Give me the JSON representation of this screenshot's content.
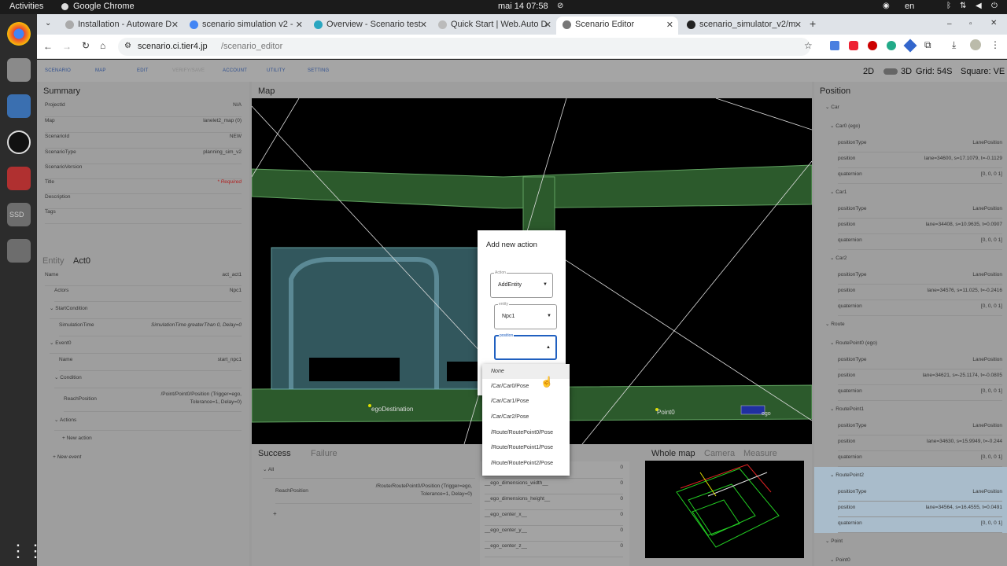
{
  "os": {
    "activities": "Activities",
    "app_name": "Google Chrome",
    "clock": "mai 14  07:58",
    "lang": "en"
  },
  "tabs": [
    {
      "label": "Installation - Autoware D"
    },
    {
      "label": "scenario simulation v2 -"
    },
    {
      "label": "Overview - Scenario test"
    },
    {
      "label": "Quick Start | Web.Auto D"
    },
    {
      "label": "Scenario Editor"
    },
    {
      "label": "scenario_simulator_v2/m"
    }
  ],
  "address": {
    "host": "scenario.ci.tier4.jp",
    "path": "/scenario_editor"
  },
  "menu": {
    "scenario": "SCENARIO",
    "map": "MAP",
    "edit": "EDIT",
    "verify": "VERIFY/SAVE",
    "account": "ACCOUNT",
    "utility": "UTILITY",
    "setting": "SETTING"
  },
  "view": {
    "d2": "2D",
    "d3": "3D",
    "grid": "Grid:  54S",
    "square": "Square:  VE"
  },
  "summary": {
    "title": "Summary",
    "rows": [
      {
        "k": "ProjectId",
        "v": "N/A"
      },
      {
        "k": "Map",
        "v": "lanelet2_map (0)"
      },
      {
        "k": "ScenarioId",
        "v": "NEW"
      },
      {
        "k": "ScenarioType",
        "v": "planning_sim_v2"
      },
      {
        "k": "ScenarioVersion",
        "v": ""
      },
      {
        "k": "Title",
        "v": "* Required"
      },
      {
        "k": "Description",
        "v": ""
      },
      {
        "k": "Tags",
        "v": ""
      }
    ]
  },
  "act": {
    "tab_entity": "Entity",
    "tab_act": "Act0",
    "name_k": "Name",
    "name_v": "act_act1",
    "actors_k": "Actors",
    "actors_v": "Npc1",
    "start_condition": "StartCondition",
    "sim_time_k": "SimulationTime",
    "sim_time_v": "SimulationTime greaterThan 0, Delay=0",
    "event0": "Event0",
    "ev_name_k": "Name",
    "ev_name_v": "start_npc1",
    "condition": "Condition",
    "reach_k": "ReachPosition",
    "reach_v1": "/Point/Point0/Position (Trigger=ego,",
    "reach_v2": "Tolerance=1, Delay=0)",
    "actions": "Actions",
    "new_action": "New action",
    "new_event": "New event"
  },
  "map": {
    "title": "Map",
    "ego_dest": "egoDestination",
    "point0": "Point0",
    "ego": "ego"
  },
  "dialog": {
    "title": "Add new action",
    "action_label": "Action",
    "action_value": "AddEntity",
    "entity_label": "entity",
    "entity_value": "Npc1",
    "position_label": "position"
  },
  "dropdown": [
    "None",
    "/Car/Car0/Pose",
    "/Car/Car1/Pose",
    "/Car/Car2/Pose",
    "/Route/RoutePoint0/Pose",
    "/Route/RoutePoint1/Pose",
    "/Route/RoutePoint2/Pose"
  ],
  "bottom": {
    "tab_success": "Success",
    "tab_failure": "Failure",
    "all": "All",
    "reach_k": "ReachPosition",
    "reach_v1": "/Route/RoutePoint0/Position (Trigger=ego,",
    "reach_v2": "Tolerance=1, Delay=0)",
    "plus": "+",
    "vars": [
      {
        "k": "",
        "v": "0"
      },
      {
        "k": "__ego_dimensions_width__",
        "v": "0"
      },
      {
        "k": "__ego_dimensions_height__",
        "v": "0"
      },
      {
        "k": "__ego_center_x__",
        "v": "0"
      },
      {
        "k": "__ego_center_y__",
        "v": "0"
      },
      {
        "k": "__ego_center_z__",
        "v": "0"
      }
    ],
    "tab_whole": "Whole map",
    "tab_camera": "Camera",
    "tab_measure": "Measure"
  },
  "position": {
    "title": "Position",
    "car": "Car",
    "car0": "Car0 (ego)",
    "car1": "Car1",
    "car2": "Car2",
    "route": "Route",
    "rp0": "RoutePoint0 (ego)",
    "rp1": "RoutePoint1",
    "rp2": "RoutePoint2",
    "point": "Point",
    "point0": "Point0",
    "pt_k": "positionType",
    "pos_k": "position",
    "q_k": "quaternion",
    "lane_pos": "LanePosition",
    "quat": "[0, 0, 0 1]",
    "car0_pos": "lane=34600, s=17.1079, t=-0.1129",
    "car1_pos": "lane=34408, s=10.9635, t=0.0907",
    "car2_pos": "lane=34576, s=11.025, t=-0.2416",
    "rp0_pos": "lane=34621, s=-25.1174, t=-0.0805",
    "rp1_pos": "lane=34630, s=15.9949, t=-0.244",
    "rp2_pos": "lane=34564, s=16.4555, t=0.0491"
  }
}
